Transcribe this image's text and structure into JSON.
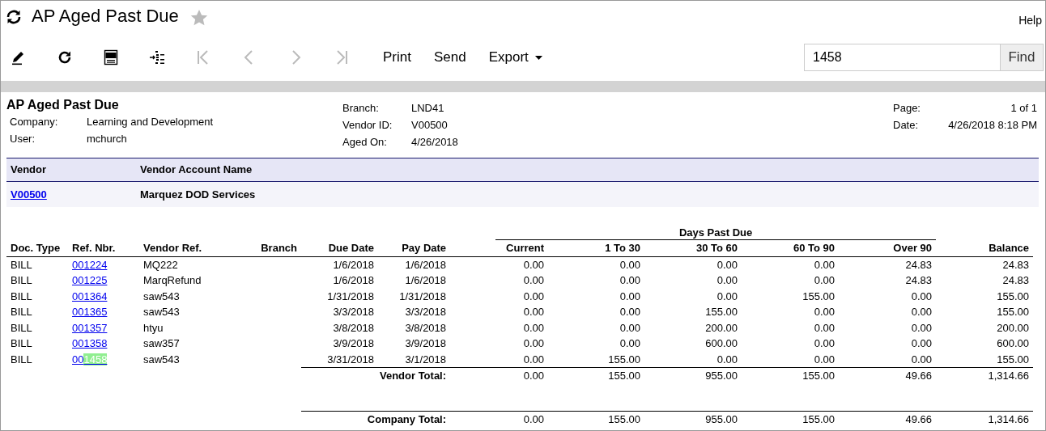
{
  "window": {
    "title": "AP Aged Past Due",
    "help": "Help"
  },
  "toolbar": {
    "icons": [
      {
        "kind": "edit",
        "disabled": false
      },
      {
        "kind": "refresh",
        "disabled": false
      },
      {
        "kind": "pdf",
        "disabled": false
      },
      {
        "kind": "tree",
        "disabled": false
      },
      {
        "kind": "first",
        "disabled": true
      },
      {
        "kind": "prev",
        "disabled": true
      },
      {
        "kind": "next",
        "disabled": true
      },
      {
        "kind": "last",
        "disabled": true
      }
    ],
    "buttons": [
      {
        "label": "Print",
        "dropdown": false
      },
      {
        "label": "Send",
        "dropdown": false
      },
      {
        "label": "Export",
        "dropdown": true
      }
    ],
    "search": {
      "value": "1458",
      "button": "Find"
    }
  },
  "report": {
    "title": "AP Aged Past Due",
    "left": [
      {
        "label": "Company:",
        "value": "Learning and Development"
      },
      {
        "label": "User:",
        "value": "mchurch"
      }
    ],
    "middle": [
      {
        "label": "Branch:",
        "value": "LND41"
      },
      {
        "label": "Vendor ID:",
        "value": "V00500"
      },
      {
        "label": "Aged On:",
        "value": "4/26/2018"
      }
    ],
    "right": [
      {
        "label": "Page:",
        "value": "1 of 1"
      },
      {
        "label": "Date:",
        "value": "4/26/2018 8:18 PM"
      }
    ]
  },
  "vendor_table": {
    "columns": [
      "Vendor",
      "Vendor Account Name"
    ],
    "row": {
      "vendor": "V00500",
      "name": "Marquez DOD Services"
    }
  },
  "detail": {
    "group_header": "Days Past Due",
    "columns": [
      "Doc. Type",
      "Ref. Nbr.",
      "Vendor Ref.",
      "Branch",
      "Due Date",
      "Pay Date",
      "Current",
      "1 To 30",
      "30 To 60",
      "60 To 90",
      "Over 90",
      "Balance"
    ],
    "rows": [
      {
        "doc_type": "BILL",
        "ref": "001224",
        "vendor_ref": "MQ222",
        "due": "1/6/2018",
        "pay": "1/6/2018",
        "amounts": [
          "0.00",
          "0.00",
          "0.00",
          "0.00",
          "24.83",
          "24.83"
        ]
      },
      {
        "doc_type": "BILL",
        "ref": "001225",
        "vendor_ref": "MarqRefund",
        "due": "1/6/2018",
        "pay": "1/6/2018",
        "amounts": [
          "0.00",
          "0.00",
          "0.00",
          "0.00",
          "24.83",
          "24.83"
        ]
      },
      {
        "doc_type": "BILL",
        "ref": "001364",
        "vendor_ref": "saw543",
        "due": "1/31/2018",
        "pay": "1/31/2018",
        "amounts": [
          "0.00",
          "0.00",
          "0.00",
          "155.00",
          "0.00",
          "155.00"
        ]
      },
      {
        "doc_type": "BILL",
        "ref": "001365",
        "vendor_ref": "saw543",
        "due": "3/3/2018",
        "pay": "3/3/2018",
        "amounts": [
          "0.00",
          "0.00",
          "155.00",
          "0.00",
          "0.00",
          "155.00"
        ]
      },
      {
        "doc_type": "BILL",
        "ref": "001357",
        "vendor_ref": "htyu",
        "due": "3/8/2018",
        "pay": "3/8/2018",
        "amounts": [
          "0.00",
          "0.00",
          "200.00",
          "0.00",
          "0.00",
          "200.00"
        ]
      },
      {
        "doc_type": "BILL",
        "ref": "001358",
        "vendor_ref": "saw357",
        "due": "3/9/2018",
        "pay": "3/9/2018",
        "amounts": [
          "0.00",
          "0.00",
          "600.00",
          "0.00",
          "0.00",
          "600.00"
        ]
      },
      {
        "doc_type": "BILL",
        "ref": "00",
        "ref_highlight": "1458",
        "vendor_ref": "saw543",
        "due": "3/31/2018",
        "pay": "3/1/2018",
        "amounts": [
          "0.00",
          "155.00",
          "0.00",
          "0.00",
          "0.00",
          "155.00"
        ]
      }
    ],
    "totals": [
      {
        "label": "Vendor Total:",
        "amounts": [
          "0.00",
          "155.00",
          "955.00",
          "155.00",
          "49.66",
          "1,314.66"
        ]
      },
      {
        "label": "Company Total:",
        "amounts": [
          "0.00",
          "155.00",
          "955.00",
          "155.00",
          "49.66",
          "1,314.66"
        ]
      }
    ]
  }
}
